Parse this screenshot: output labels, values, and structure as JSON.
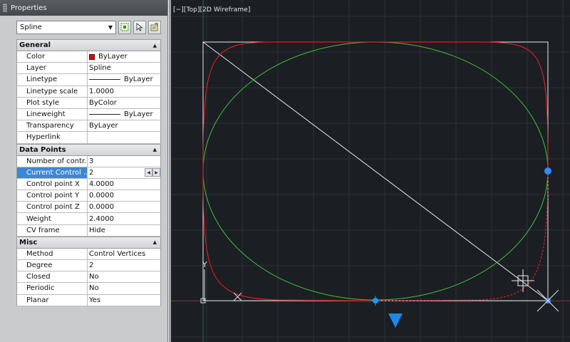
{
  "palette": {
    "title": "Properties",
    "object_type": "Spline",
    "buttons": [
      "select-objects-icon",
      "quick-select-icon",
      "pickadd-toggle-icon"
    ]
  },
  "sections": [
    {
      "name": "General",
      "rows": [
        {
          "label": "Color",
          "value": "ByLayer",
          "swatch": "#d01010"
        },
        {
          "label": "Layer",
          "value": "Spline"
        },
        {
          "label": "Linetype",
          "value": "ByLayer",
          "line": true
        },
        {
          "label": "Linetype scale",
          "value": "1.0000"
        },
        {
          "label": "Plot style",
          "value": "ByColor"
        },
        {
          "label": "Lineweight",
          "value": "ByLayer",
          "line": true
        },
        {
          "label": "Transparency",
          "value": "ByLayer"
        },
        {
          "label": "Hyperlink",
          "value": ""
        }
      ]
    },
    {
      "name": "Data Points",
      "rows": [
        {
          "label": "Number of contr...",
          "value": "3"
        },
        {
          "label": "Current Control ...",
          "value": "2",
          "selected": true
        },
        {
          "label": "Control point X",
          "value": "4.0000"
        },
        {
          "label": "Control point Y",
          "value": "0.0000"
        },
        {
          "label": "Control point Z",
          "value": "0.0000"
        },
        {
          "label": "Weight",
          "value": "2.4000"
        },
        {
          "label": "CV frame",
          "value": "Hide"
        }
      ]
    },
    {
      "name": "Misc",
      "rows": [
        {
          "label": "Method",
          "value": "Control Vertices"
        },
        {
          "label": "Degree",
          "value": "2"
        },
        {
          "label": "Closed",
          "value": "No"
        },
        {
          "label": "Periodic",
          "value": "No"
        },
        {
          "label": "Planar",
          "value": "Yes"
        }
      ]
    }
  ],
  "viewport": {
    "label": "[−][Top][2D Wireframe]",
    "ucs_y_label": "Y",
    "colors": {
      "background": "#1b1e23",
      "grid": "#2c3037",
      "red_spline": "#d42020",
      "green_ellipse": "#3cc23c",
      "white": "#e8e8e8",
      "grip_blue": "#2f8cff"
    }
  }
}
